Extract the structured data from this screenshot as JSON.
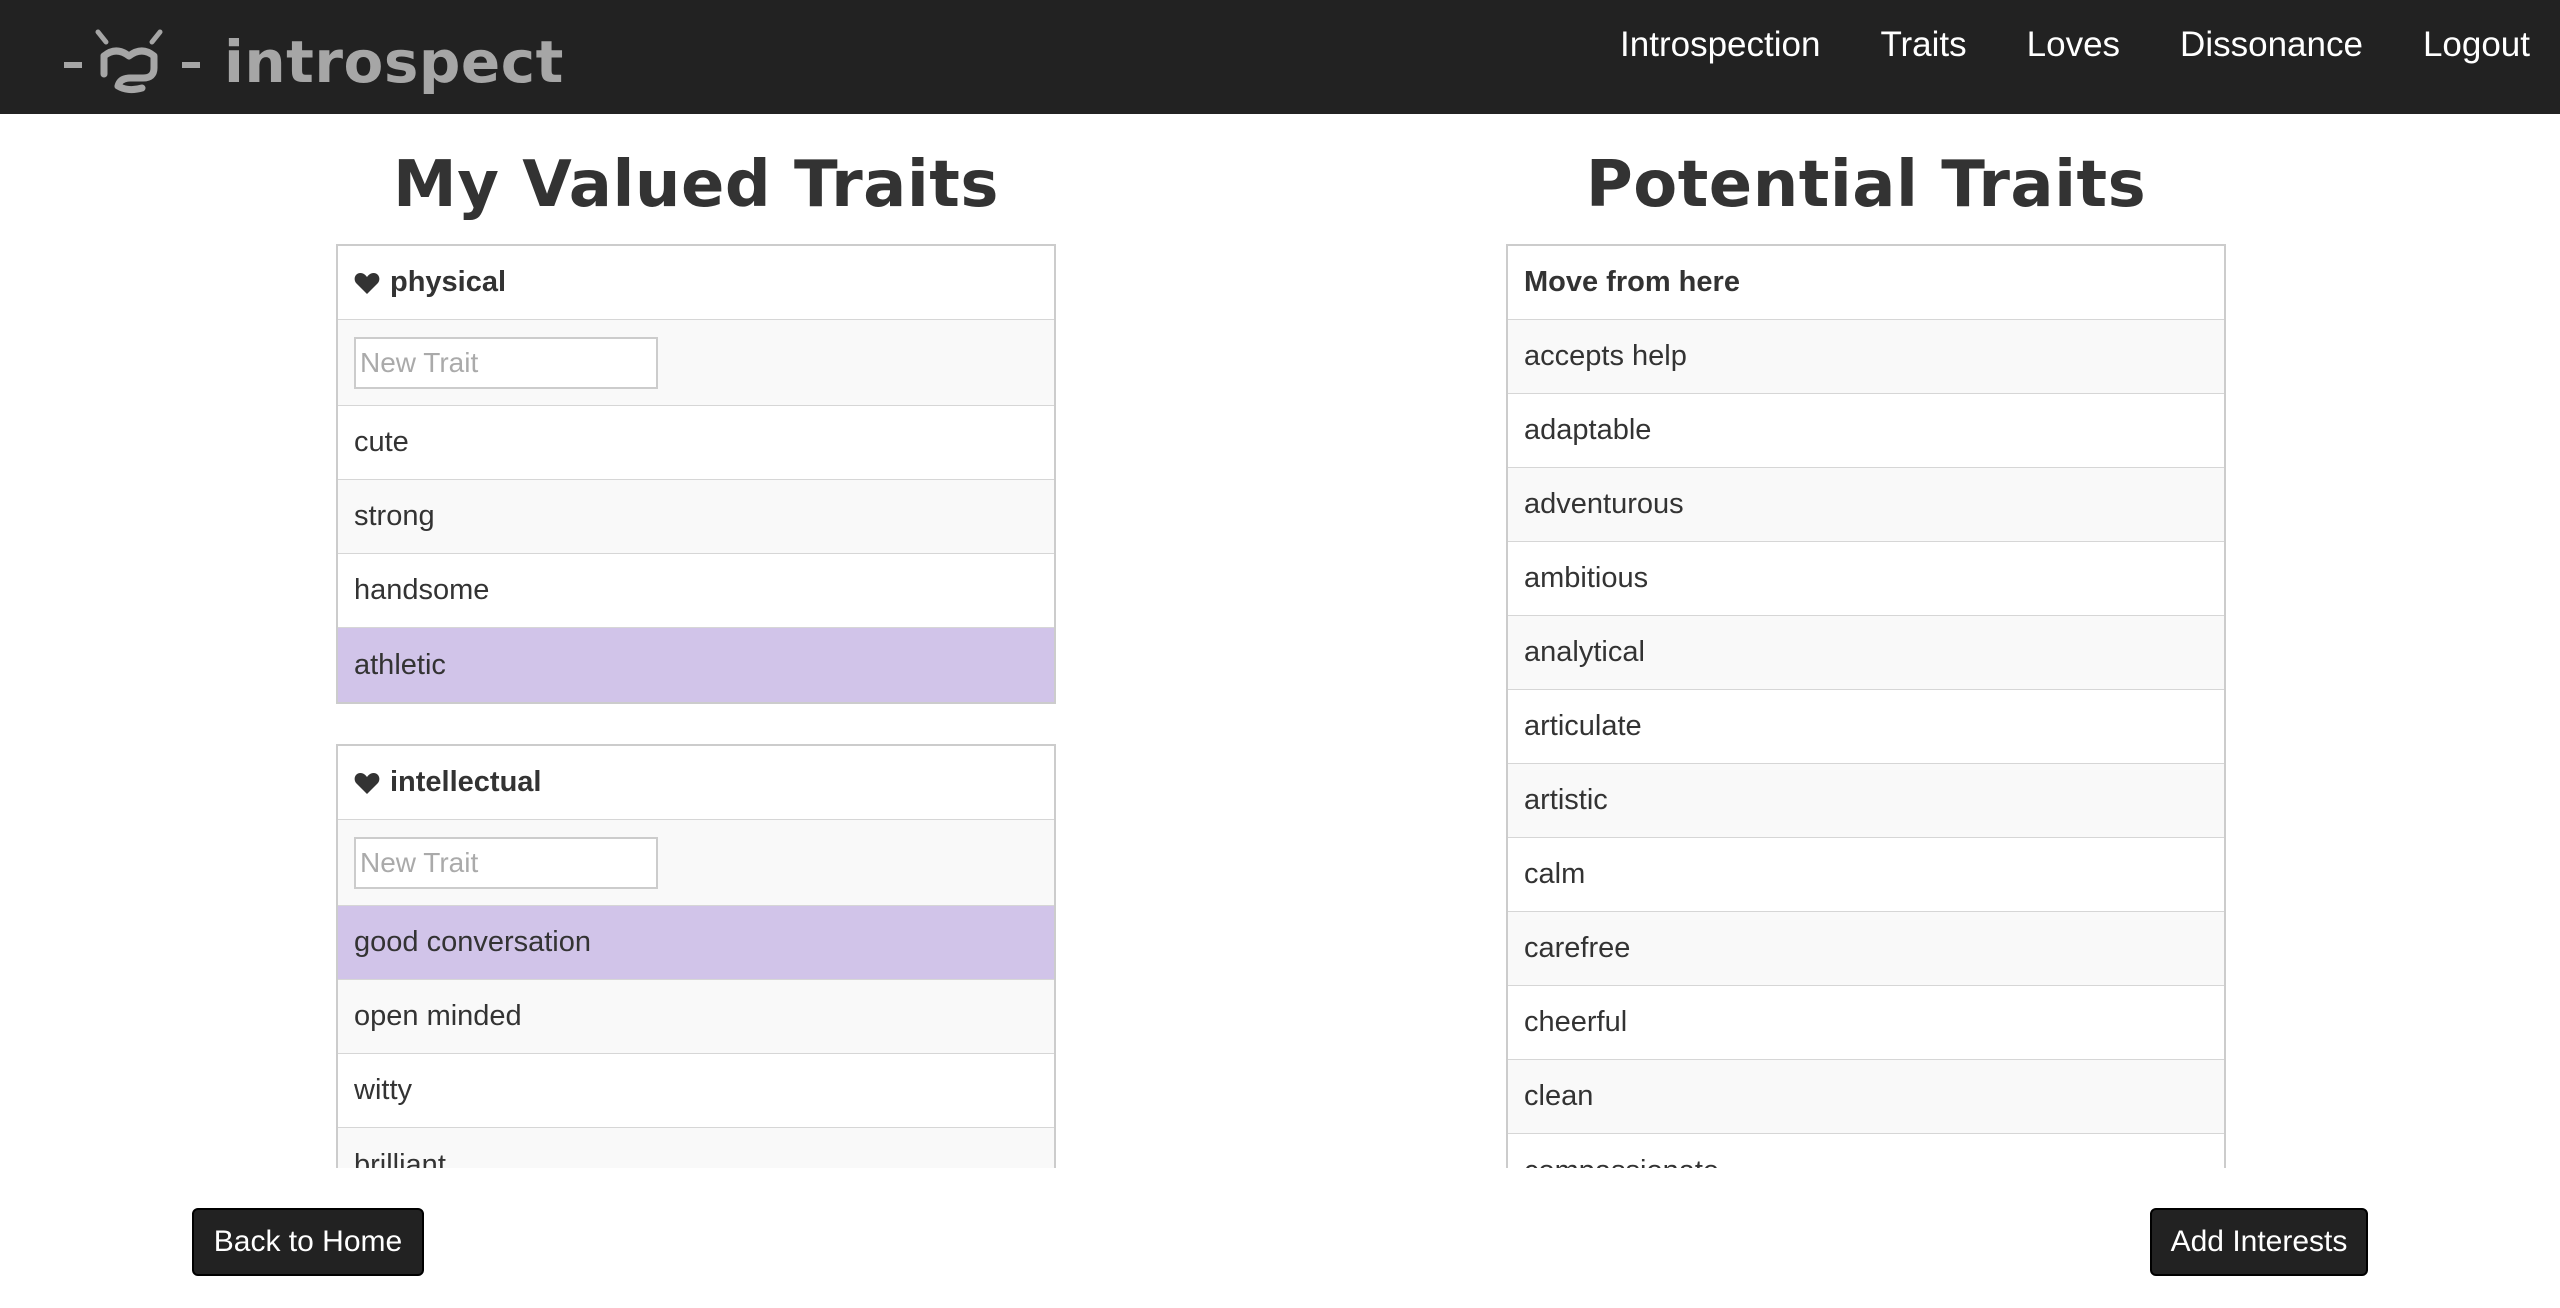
{
  "brand": {
    "name": "introspect"
  },
  "nav": {
    "links": [
      "Introspection",
      "Traits",
      "Loves",
      "Dissonance",
      "Logout"
    ]
  },
  "valued": {
    "title": "My Valued Traits",
    "groups": [
      {
        "name": "physical",
        "input_placeholder": "New Trait",
        "items": [
          "cute",
          "strong",
          "handsome",
          "athletic"
        ],
        "selected": [
          "athletic"
        ]
      },
      {
        "name": "intellectual",
        "input_placeholder": "New Trait",
        "items": [
          "good conversation",
          "open minded",
          "witty",
          "brilliant"
        ],
        "selected": [
          "good conversation"
        ]
      }
    ]
  },
  "potential": {
    "title": "Potential Traits",
    "header": "Move from here",
    "items": [
      "accepts help",
      "adaptable",
      "adventurous",
      "ambitious",
      "analytical",
      "articulate",
      "artistic",
      "calm",
      "carefree",
      "cheerful",
      "clean",
      "compassionate"
    ]
  },
  "buttons": {
    "back": "Back to Home",
    "add": "Add Interests"
  },
  "colors": {
    "navbar": "#222222",
    "selected_row": "#d1c4e9",
    "striped_row": "#f9f9f9",
    "brand_text": "#a6a6a6"
  },
  "icons": {
    "group_header": "heart-icon",
    "logo": "logo-icon"
  }
}
